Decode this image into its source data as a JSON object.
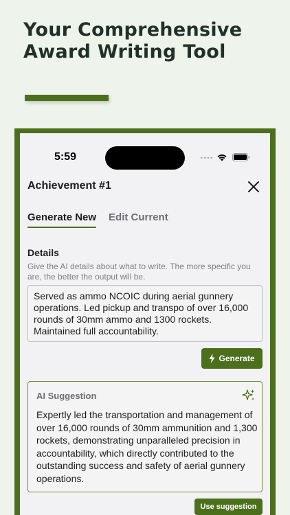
{
  "hero": {
    "title": "Your Comprehensive Award Writing Tool"
  },
  "status_bar": {
    "time": "5:59",
    "signal": "••••"
  },
  "sheet": {
    "title": "Achievement #1",
    "close_icon": "close-icon"
  },
  "tabs": [
    {
      "label": "Generate New",
      "active": true
    },
    {
      "label": "Edit Current",
      "active": false
    }
  ],
  "details": {
    "label": "Details",
    "help": "Give the AI details about what to write. The more specific you are, the better the output will be.",
    "value": "Served as ammo NCOIC during aerial gunnery operations. Led pickup and transpo of over 16,000 rounds of 30mm ammo and 1300 rockets. Maintained full accountability."
  },
  "generate_button": {
    "label": "Generate",
    "icon": "lightning-icon"
  },
  "suggestion": {
    "title": "AI Suggestion",
    "icon": "sparkles-icon",
    "body": "Expertly led the transportation and management of over 16,000 rounds of 30mm ammunition and 1,300 rockets, demonstrating unparalleled precision in accountability, which directly contributed to the outstanding success and safety of aerial gunnery operations."
  },
  "use_button": {
    "label": "Use suggestion"
  },
  "colors": {
    "accent": "#4c6f1c",
    "background": "#eef4ec",
    "screen": "#f2f2f4"
  }
}
